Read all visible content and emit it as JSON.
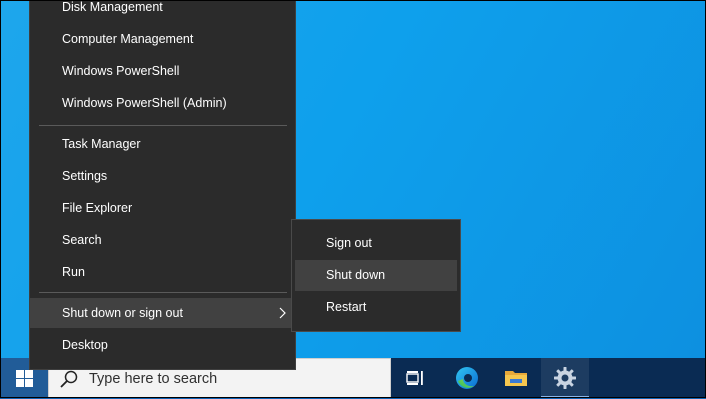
{
  "context_menu": {
    "items": [
      {
        "label": "Disk Management"
      },
      {
        "label": "Computer Management"
      },
      {
        "label": "Windows PowerShell"
      },
      {
        "label": "Windows PowerShell (Admin)"
      },
      {
        "label": "Task Manager"
      },
      {
        "label": "Settings"
      },
      {
        "label": "File Explorer"
      },
      {
        "label": "Search"
      },
      {
        "label": "Run"
      },
      {
        "label": "Shut down or sign out"
      },
      {
        "label": "Desktop"
      }
    ],
    "highlighted": "Shut down or sign out"
  },
  "submenu": {
    "items": [
      {
        "label": "Sign out"
      },
      {
        "label": "Shut down"
      },
      {
        "label": "Restart"
      }
    ],
    "highlighted": "Shut down"
  },
  "taskbar": {
    "search_placeholder": "Type here to search",
    "icons": [
      "windows-logo-icon",
      "search-icon",
      "task-view-icon",
      "edge-icon",
      "file-explorer-icon",
      "settings-gear-icon"
    ]
  },
  "colors": {
    "desktop": "#16a0ea",
    "menu_bg": "#2b2b2b",
    "menu_highlight": "#414141",
    "taskbar": "#0a2b53"
  }
}
